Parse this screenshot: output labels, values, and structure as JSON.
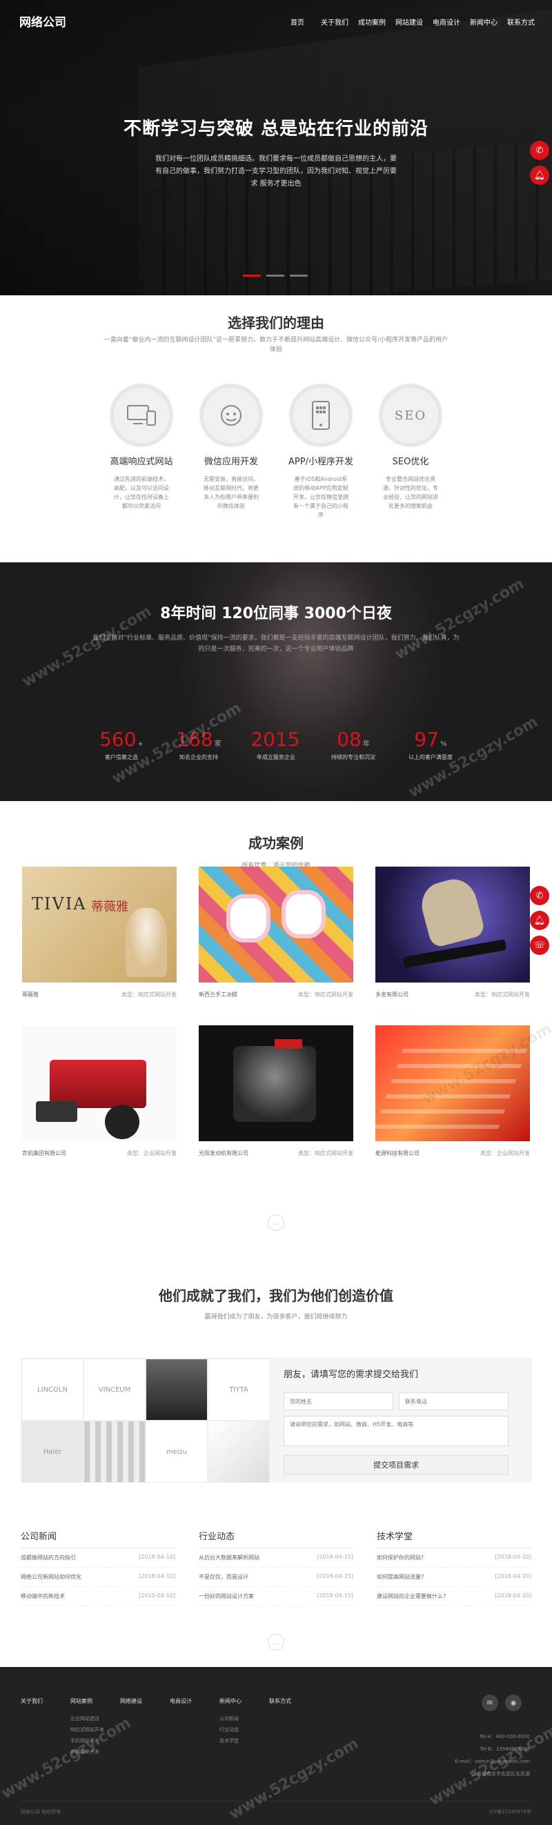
{
  "brand": {
    "logo": "网络公司",
    "accent": "#d9121b"
  },
  "nav": [
    "首页",
    "关于我们",
    "成功案例",
    "网站建设",
    "电商设计",
    "新闻中心",
    "联系方式"
  ],
  "hero": {
    "title": "不断学习与突破 总是站在行业的前沿",
    "text": "我们对每一位团队成员精挑细选。我们要求每一位成员都做自己思想的主人，要有自己的做事，我们努力打造一支学习型的团队，因为我们对知、视觉上严厉要求 服务才更出色",
    "slides": 3,
    "active_slide": 1
  },
  "float_icons": [
    "phone-icon",
    "bell-icon",
    "chat-icon"
  ],
  "why": {
    "title": "选择我们的理由",
    "subtitle": "一直向着“做业内一流的互联网设计团队”这一愿景努力，致力于不断提升网站高端设计、微信公众号/小程序开发等产品的用户体验",
    "items": [
      {
        "title": "高端响应式网站",
        "text": "通过先进的前端技术，高配，以及可以访问设计，让您在任何设备上都可以完美访问",
        "icon": "devices-icon"
      },
      {
        "title": "微信应用开发",
        "text": "无需安装，直接访问，移动互联网时代，将更多人为你用户带来便利的微信体验",
        "icon": "wechat-icon"
      },
      {
        "title": "APP/小程序开发",
        "text": "基于iOS和Android系统的移动APP应用定制开发，让您在微信里拥有一个属于自己的小程序",
        "icon": "mobile-icon"
      },
      {
        "title": "SEO优化",
        "text": "专业整合网站优化资源，针对性的优化，专业经验，让您的网站排名更多的搜索机会",
        "icon": "seo-icon"
      }
    ]
  },
  "stats": {
    "title": "8年时间  120位同事  3000个日夜",
    "text": "我们坚持对“行业标准、服务品质、价值观”保持一流的要求，我们都是一支经验丰富的高端互联网设计团队，我们努力、我们认真，为的只是一次服务，完美的一次，这一个专业用户体验品牌",
    "items": [
      {
        "value": "560",
        "unit": "+",
        "label": "客户信赖之选"
      },
      {
        "value": "168",
        "unit": "家",
        "label": "知名企业的支持"
      },
      {
        "value": "2015",
        "unit": "",
        "label": "年成立服务企业"
      },
      {
        "value": "08",
        "unit": "年",
        "label": "持续的专注和沉淀"
      },
      {
        "value": "97",
        "unit": "%",
        "label": "以上的客户满意度"
      }
    ]
  },
  "cases": {
    "title": "成功案例",
    "subtitle": "所有优秀，源于您的信赖",
    "items": [
      {
        "name": "蒂薇雅",
        "cat": "类型：响应式网站开发"
      },
      {
        "name": "新西兰手工冰糕",
        "cat": "类型：响应式网站开发"
      },
      {
        "name": "多金有限公司",
        "cat": "类型：响应式网站开发"
      },
      {
        "name": "农机集团有限公司",
        "cat": "类型：企业网站开发"
      },
      {
        "name": "光阳发动机有限公司",
        "cat": "类型：响应式网站开发"
      },
      {
        "name": "能源科技有限公司",
        "cat": "类型：企业网站开发"
      }
    ],
    "more": "..."
  },
  "partners": {
    "title": "他们成就了我们，我们为他们创造价值",
    "subtitle": "赢得我们成为了朋友，为很多客户，我们将继续努力",
    "brands": [
      "LINCOLN",
      "VINCEUM",
      "",
      "TIYTA",
      "Haier",
      "",
      "meizu",
      ""
    ],
    "form": {
      "title": "朋友，请填写您的需求提交给我们",
      "name_placeholder": "您的姓名",
      "phone_placeholder": "联系电话",
      "msg_placeholder": "请说明您的需求，如网站、微商、H5开发、电商等",
      "submit": "提交项目需求"
    }
  },
  "news": [
    {
      "title": "公司新闻",
      "items": [
        {
          "t": "成都做网站的方向指引",
          "d": "[2018-04-10]"
        },
        {
          "t": "网络公司新网站如何优化",
          "d": "[2018-04-10]"
        },
        {
          "t": "移动端中的新技术",
          "d": "[2015-04-10]"
        }
      ]
    },
    {
      "title": "行业动态",
      "items": [
        {
          "t": "从后台大数据来解析网站",
          "d": "[2018-04-15]"
        },
        {
          "t": "不是仅仅，而是设计",
          "d": "[2018-04-15]"
        },
        {
          "t": "一份好的网站设计方案",
          "d": "[2018-04-15]"
        }
      ]
    },
    {
      "title": "技术学堂",
      "items": [
        {
          "t": "如何保护你的网站?",
          "d": "[2018-04-10]"
        },
        {
          "t": "如何提高网站流量?",
          "d": "[2018-04-10]"
        },
        {
          "t": "建设网站的企业需要做什么?",
          "d": "[2018-04-10]"
        }
      ]
    }
  ],
  "footer": {
    "cols": [
      {
        "title": "关于我们",
        "links": []
      },
      {
        "title": "网站案例",
        "links": [
          "企业网站建设",
          "响应式网站开发",
          "手机网站开发",
          "商城网站开发"
        ]
      },
      {
        "title": "网络建设",
        "links": []
      },
      {
        "title": "电商设计",
        "links": []
      },
      {
        "title": "新闻中心",
        "links": [
          "公司新闻",
          "行业动态",
          "技术学堂"
        ]
      },
      {
        "title": "联系方式",
        "links": []
      }
    ],
    "contact": [
      "Tel-A：400-000-0000",
      "Tel-B：13588888888",
      "E-mail：admin@yoursweb.com",
      "江苏省南京市玄武区玄武湖"
    ],
    "copyright": "网络公司   版权所有",
    "icp": "ICP备12345678号"
  },
  "watermark": "www.52cgzy.com"
}
